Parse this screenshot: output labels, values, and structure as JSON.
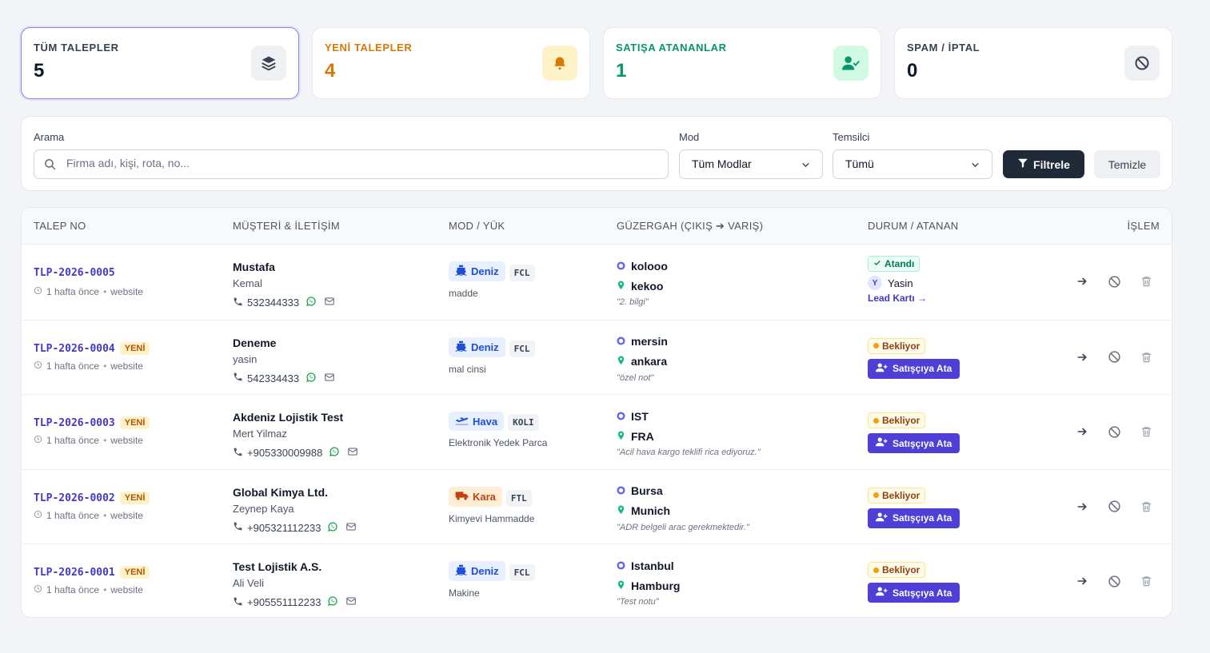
{
  "stats": [
    {
      "label": "TÜM TALEPLER",
      "value": "5",
      "icon": "layers-icon"
    },
    {
      "label": "YENİ TALEPLER",
      "value": "4",
      "icon": "bell-icon"
    },
    {
      "label": "SATIŞA ATANANLAR",
      "value": "1",
      "icon": "user-check-icon"
    },
    {
      "label": "SPAM / İPTAL",
      "value": "0",
      "icon": "ban-icon"
    }
  ],
  "filters": {
    "search_label": "Arama",
    "search_placeholder": "Firma adı, kişi, rota, no...",
    "mode_label": "Mod",
    "mode_value": "Tüm Modlar",
    "rep_label": "Temsilci",
    "rep_value": "Tümü",
    "filter_button": "Filtrele",
    "clear_button": "Temizle"
  },
  "table": {
    "headers": {
      "no": "TALEP NO",
      "customer": "MÜŞTERİ & İLETİŞİM",
      "mode": "MOD / YÜK",
      "route": "GÜZERGAH (ÇIKIŞ ➔ VARIŞ)",
      "status": "DURUM / ATANAN",
      "action": "İŞLEM"
    },
    "rows": [
      {
        "no": "TLP-2026-0005",
        "new": "",
        "time": "1 hafta önce",
        "source": "website",
        "company": "Mustafa",
        "person": "Kemal",
        "phone": "532344333",
        "mode": "Deniz",
        "mode_kind": "sea",
        "load": "FCL",
        "cargo": "madde",
        "from": "kolooo",
        "to": "kekoo",
        "note": "\"2. bilgi\"",
        "status": "Atandı",
        "status_kind": "ok",
        "assignee": "Yasin",
        "assignee_initial": "Y",
        "link": "Lead Kartı →"
      },
      {
        "no": "TLP-2026-0004",
        "new": "YENİ",
        "time": "1 hafta önce",
        "source": "website",
        "company": "Deneme",
        "person": "yasin",
        "phone": "542334433",
        "mode": "Deniz",
        "mode_kind": "sea",
        "load": "FCL",
        "cargo": "mal cinsi",
        "from": "mersin",
        "to": "ankara",
        "note": "\"özel not\"",
        "status": "Bekliyor",
        "status_kind": "wait",
        "assign_button": "Satışçıya Ata"
      },
      {
        "no": "TLP-2026-0003",
        "new": "YENİ",
        "time": "1 hafta önce",
        "source": "website",
        "company": "Akdeniz Lojistik Test",
        "person": "Mert Yilmaz",
        "phone": "+905330009988",
        "mode": "Hava",
        "mode_kind": "air",
        "load": "KOLI",
        "cargo": "Elektronik Yedek Parca",
        "from": "IST",
        "to": "FRA",
        "note": "\"Acil hava kargo teklifi rica ediyoruz.\"",
        "status": "Bekliyor",
        "status_kind": "wait",
        "assign_button": "Satışçıya Ata"
      },
      {
        "no": "TLP-2026-0002",
        "new": "YENİ",
        "time": "1 hafta önce",
        "source": "website",
        "company": "Global Kimya Ltd.",
        "person": "Zeynep Kaya",
        "phone": "+905321112233",
        "mode": "Kara",
        "mode_kind": "road",
        "load": "FTL",
        "cargo": "Kimyevi Hammadde",
        "from": "Bursa",
        "to": "Munich",
        "note": "\"ADR belgeli arac gerekmektedir.\"",
        "status": "Bekliyor",
        "status_kind": "wait",
        "assign_button": "Satışçıya Ata"
      },
      {
        "no": "TLP-2026-0001",
        "new": "YENİ",
        "time": "1 hafta önce",
        "source": "website",
        "company": "Test Lojistik A.S.",
        "person": "Ali Veli",
        "phone": "+905551112233",
        "mode": "Deniz",
        "mode_kind": "sea",
        "load": "FCL",
        "cargo": "Makine",
        "from": "Istanbul",
        "to": "Hamburg",
        "note": "\"Test notu\"",
        "status": "Bekliyor",
        "status_kind": "wait",
        "assign_button": "Satışçıya Ata"
      }
    ]
  },
  "colors": {
    "accent": "#4338ca",
    "assign": "#4f3fd6",
    "new": "#d97706",
    "assigned": "#059669"
  }
}
